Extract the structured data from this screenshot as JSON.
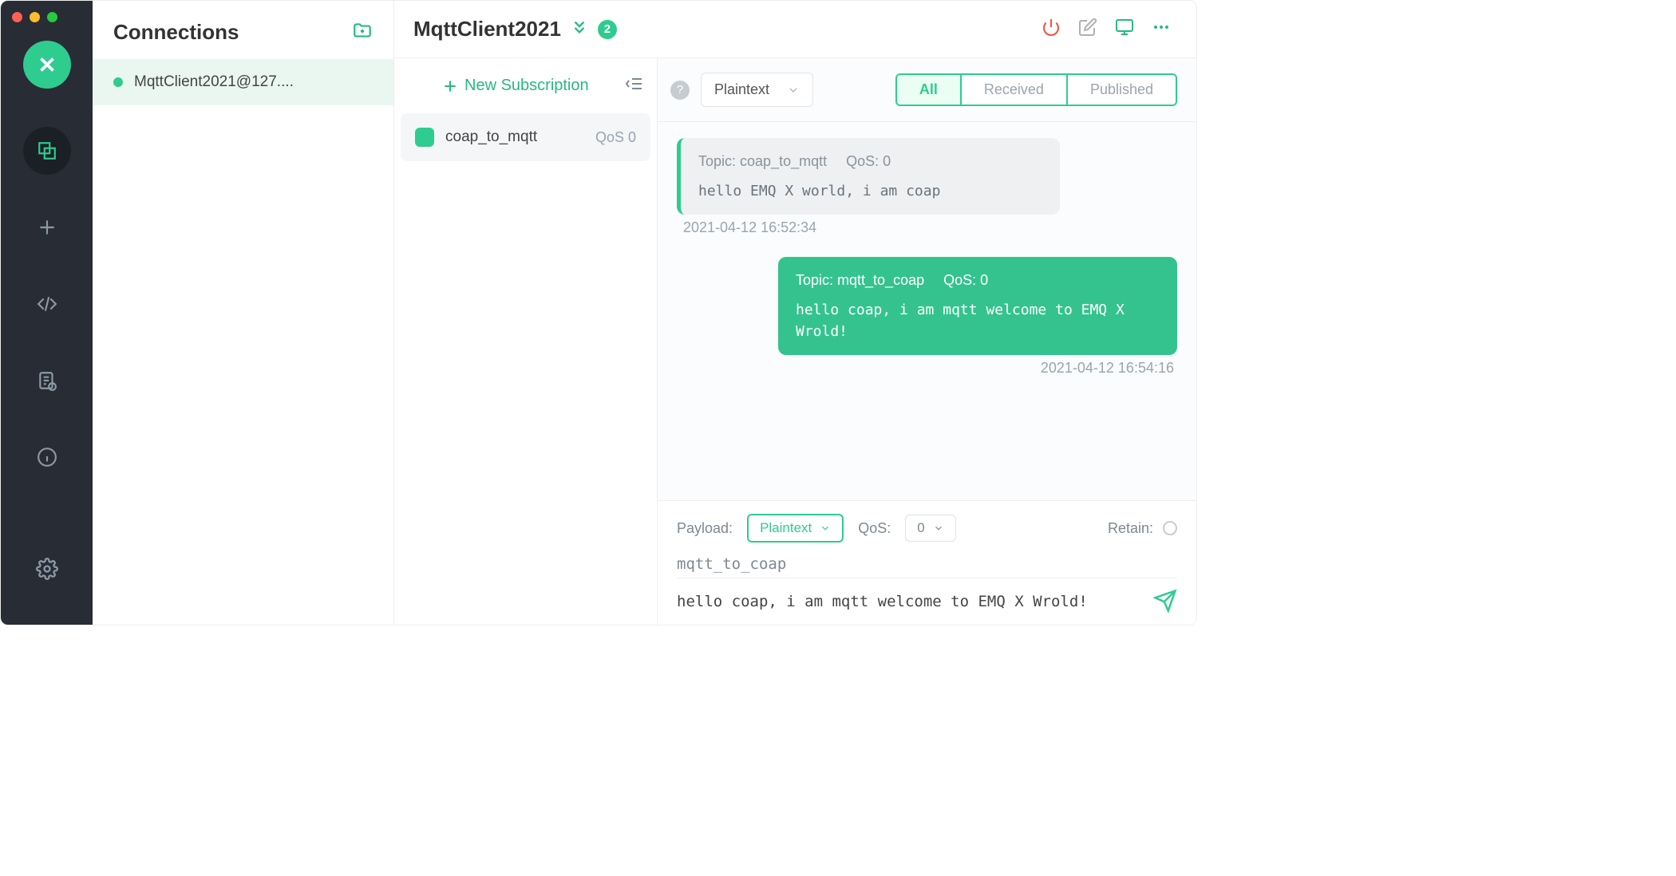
{
  "nav": {
    "active": "connections"
  },
  "connections": {
    "title": "Connections",
    "items": [
      {
        "name": "MqttClient2021@127....",
        "status": "online"
      }
    ]
  },
  "main": {
    "title": "MqttClient2021",
    "badge": "2"
  },
  "toolbar": {
    "new_subscription": "New Subscription",
    "decode_select": "Plaintext",
    "tabs": {
      "all": "All",
      "received": "Received",
      "published": "Published",
      "active": "all"
    }
  },
  "subscriptions": [
    {
      "topic": "coap_to_mqtt",
      "qos_label": "QoS 0",
      "color": "#2ecc8f"
    }
  ],
  "messages": [
    {
      "dir": "recv",
      "topic_label": "Topic: coap_to_mqtt",
      "qos_label": "QoS: 0",
      "body": "hello EMQ X world, i am coap",
      "ts": "2021-04-12 16:52:34"
    },
    {
      "dir": "sent",
      "topic_label": "Topic: mqtt_to_coap",
      "qos_label": "QoS: 0",
      "body": "hello coap, i am mqtt welcome to EMQ X Wrold!",
      "ts": "2021-04-12 16:54:16"
    }
  ],
  "composer": {
    "payload_label": "Payload:",
    "payload_select": "Plaintext",
    "qos_label": "QoS:",
    "qos_value": "0",
    "retain_label": "Retain:",
    "topic": "mqtt_to_coap",
    "body": "hello coap, i am mqtt welcome to EMQ X Wrold!"
  }
}
